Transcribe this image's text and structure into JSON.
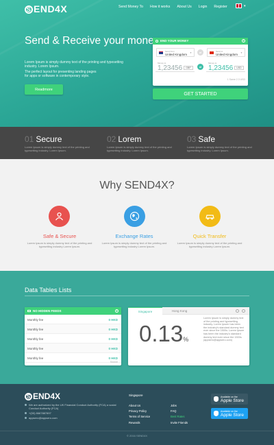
{
  "brand": {
    "logo_letter": "S",
    "logo_text": "END4X"
  },
  "nav": {
    "items": [
      "Send Money To",
      "How it works",
      "About Us",
      "Login",
      "Register"
    ],
    "lang_caret": "▾"
  },
  "hero": {
    "title": "Send & Receive your money",
    "text1": "Lorem Ipsum is simply dummy text of the printing and typesetting industry. Lorem Ipsum.",
    "text2": "The perfect layout for presenting landing pages for apps or software in contemporary style.",
    "button": "Readmore"
  },
  "send_card": {
    "title": "END YOUR MONEY",
    "info": "i",
    "from_label": "Send from",
    "from_country": "United Kingdom",
    "to_label": "Send to",
    "to_country": "United Kingdom",
    "amount_from_label": "Money to",
    "amount_from": "1,23456",
    "currency_from": "GBP",
    "amount_to_label": "Money to",
    "amount_to": "1,23456",
    "currency_to": "USD",
    "rate": "1 Same 2.3 USD",
    "cta": "GET STARTED"
  },
  "features": [
    {
      "num": "01",
      "title": "Secure",
      "desc": "Lorem Ipsum is simply dummy text of the printing and typesetting industry. Lorem Ipsum."
    },
    {
      "num": "02",
      "title": "Lorem",
      "desc": "Lorem Ipsum is simply dummy text of the printing and typesetting industry. Lorem Ipsum."
    },
    {
      "num": "03",
      "title": "Safe",
      "desc": "Lorem Ipsum is simply dummy text of the printing and typesetting industry. Lorem Ipsum."
    }
  ],
  "why": {
    "title": "Why SEND4X?",
    "items": [
      {
        "title": "Safe & Secure",
        "color": "#e8524f",
        "icon": "users-icon",
        "desc": "Lorem Ipsum is simply dummy text of the printing and typesetting industry Lorem Ipsum."
      },
      {
        "title": "Exchange Rates",
        "color": "#3a9fe3",
        "icon": "globe-icon",
        "desc": "Lorem Ipsum is simply dummy text of the printing and typesetting industry Lorem Ipsum."
      },
      {
        "title": "Quick Transfer",
        "color": "#f2bb16",
        "icon": "car-icon",
        "desc": "Lorem Ipsum is simply dummy text of the printing and typesetting industry Lorem Ipsum."
      }
    ]
  },
  "tables": {
    "title": "Data Tables Lists",
    "fees": {
      "title": "NO HIDDEN FEEDS",
      "info": "i",
      "rows": [
        {
          "label": "Monthly fee",
          "value": "0 HKD"
        },
        {
          "label": "Monthly fee",
          "value": "0 HKD"
        },
        {
          "label": "Monthly fee",
          "value": "0 HKD"
        },
        {
          "label": "Monthly fee",
          "value": "0 HKD"
        },
        {
          "label": "Monthly fee",
          "value": "0 HKD"
        }
      ],
      "source": "Source"
    },
    "rate_tabs": [
      "Singapore",
      "Hong Kong"
    ],
    "rate_value": "0.13",
    "rate_unit": "%",
    "rate_desc": "Lorem Ipsum is simply dummy text of the printing and typesetting industry. Lorem Ipsum has been the industry's standard dummy text ever since the 1500s. Lorem Ipsum has been the industry's standard dummy text ever since the 1500s (appsero@appsero.com)"
  },
  "footer": {
    "logo_letter": "S",
    "logo_text": "END4X",
    "lines": [
      "We are authorized by the UK Financial Conduct Authority (FCA) a social Conduct Authority (FCA)",
      "+(00) 8667887897",
      "appsero@appsero.com"
    ],
    "city": "Singapore",
    "col1": [
      "About Us",
      "Privacy Policy",
      "Terms of Service",
      "Rewards"
    ],
    "col2": [
      "Jobs",
      "FAQ",
      "Best Rates",
      "Invite Friends"
    ],
    "store1_small": "Available on the",
    "store1": "Apple Store",
    "store2_small": "Available on the",
    "store2": "Apple Store",
    "copyright": "© 2016 SEND4X"
  },
  "colors": {
    "teal": "#3aa99a",
    "green": "#3fd27b",
    "dark": "#464646",
    "footer": "#2c4d5a"
  }
}
